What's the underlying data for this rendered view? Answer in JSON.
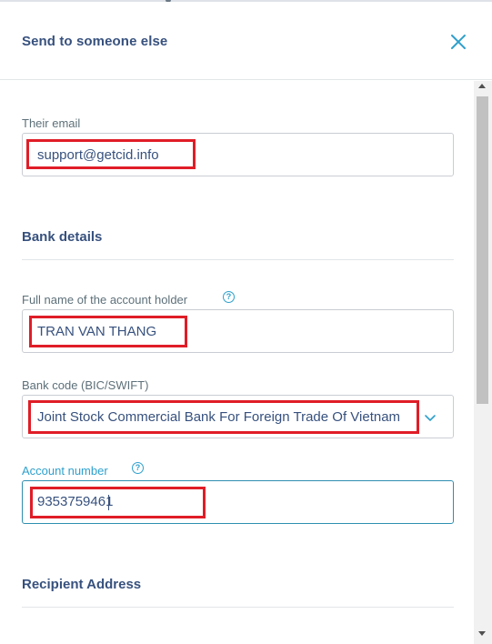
{
  "dialog": {
    "title": "Send to someone else",
    "close_icon": "close-icon"
  },
  "email": {
    "label": "Their email",
    "value": "support@getcid.info"
  },
  "bank_details": {
    "title": "Bank details"
  },
  "account_holder": {
    "label": "Full name of the account holder",
    "help_icon": "help-circle-icon",
    "value": "TRAN VAN THANG"
  },
  "bank_code": {
    "label": "Bank code (BIC/SWIFT)",
    "value": "Joint Stock Commercial Bank For Foreign Trade Of Vietnam",
    "dropdown_icon": "chevron-down-icon"
  },
  "account_number": {
    "label": "Account number",
    "help_icon": "help-circle-icon",
    "value": "9353759461"
  },
  "recipient_address": {
    "title": "Recipient Address"
  },
  "colors": {
    "text": "#37517e",
    "label": "#5d7079",
    "accent": "#2ea0cc",
    "highlight": "#e01d27"
  }
}
